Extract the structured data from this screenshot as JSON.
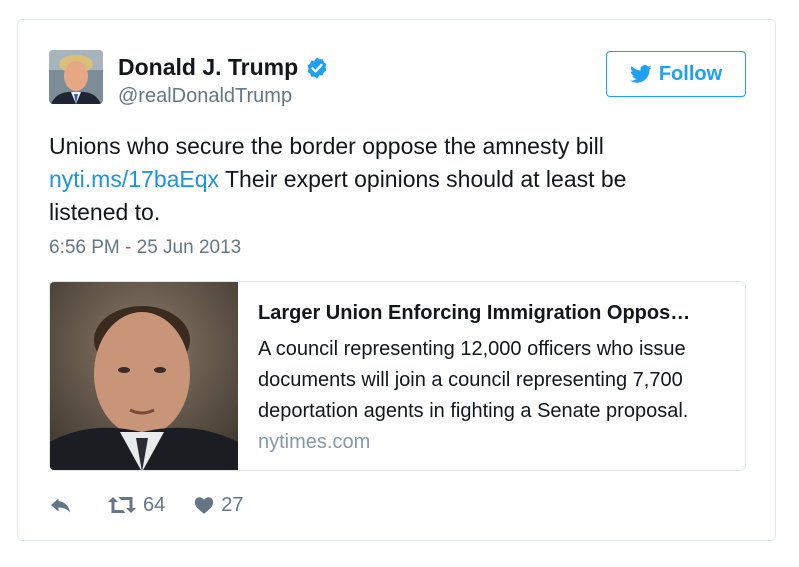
{
  "tweet": {
    "display_name": "Donald J. Trump",
    "handle": "@realDonaldTrump",
    "follow_label": "Follow",
    "text_part1": "Unions who secure the border oppose the amnesty bill ",
    "link_text": "nyti.ms/17baEqx",
    "text_part2": " Their expert opinions should at least be listened to.",
    "timestamp": "6:56 PM - 25 Jun 2013",
    "retweet_count": "64",
    "like_count": "27"
  },
  "card": {
    "title": "Larger Union Enforcing Immigration Oppos…",
    "description": "A council representing 12,000 officers who issue documents will join a council representing 7,700 deportation agents in fighting a Senate proposal.",
    "domain": "nytimes.com"
  },
  "colors": {
    "accent": "#1da1f2",
    "link": "#1b95e0",
    "muted": "#657786",
    "border": "#e1e8ed"
  },
  "icons": {
    "verified": "verified-badge-icon",
    "follow": "twitter-bird-icon",
    "reply": "reply-icon",
    "retweet": "retweet-icon",
    "like": "heart-icon"
  }
}
